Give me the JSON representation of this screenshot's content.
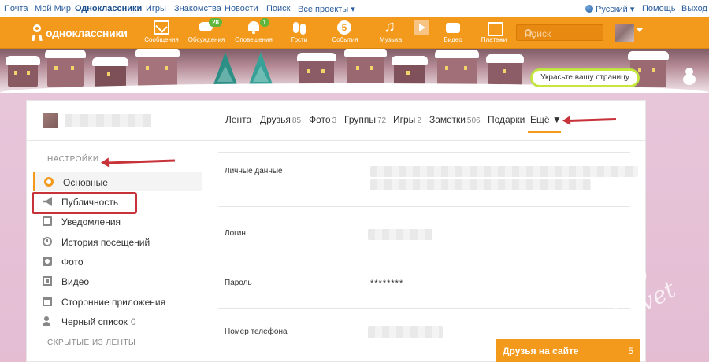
{
  "portal_bar": {
    "items": [
      "Почта",
      "Мой Мир",
      "Одноклассники",
      "Игры",
      "Знакомства",
      "Новости",
      "Поиск",
      "Все проекты"
    ],
    "language": "Русский",
    "help": "Помощь",
    "logout": "Выход"
  },
  "header": {
    "logo_text": "одноклассники",
    "nav": [
      {
        "label": "Сообщения",
        "icon": "mail-icon"
      },
      {
        "label": "Обсуждения",
        "icon": "chat-icon",
        "badge": "28"
      },
      {
        "label": "Оповещения",
        "icon": "bell-icon",
        "badge": "1"
      },
      {
        "label": "Гости",
        "icon": "guests-icon"
      },
      {
        "label": "События",
        "icon": "events-icon"
      },
      {
        "label": "Музыка",
        "icon": "music-icon"
      },
      {
        "label": "",
        "icon": "play-icon"
      },
      {
        "label": "Видео",
        "icon": "video-icon"
      },
      {
        "label": "Платежи",
        "icon": "payments-icon"
      }
    ],
    "search_placeholder": "Поиск"
  },
  "banner": {
    "decorate_label": "Украсьте вашу страницу"
  },
  "profile_tabs": [
    {
      "label": "Лента",
      "count": ""
    },
    {
      "label": "Друзья",
      "count": "85"
    },
    {
      "label": "Фото",
      "count": "3"
    },
    {
      "label": "Группы",
      "count": "72"
    },
    {
      "label": "Игры",
      "count": "2"
    },
    {
      "label": "Заметки",
      "count": "506"
    },
    {
      "label": "Подарки",
      "count": ""
    }
  ],
  "more_tab": "Ещё ▼",
  "sidebar": {
    "section_title": "НАСТРОЙКИ",
    "items": [
      {
        "label": "Основные",
        "icon": "gear-icon",
        "count": ""
      },
      {
        "label": "Публичность",
        "icon": "megaphone-icon",
        "count": ""
      },
      {
        "label": "Уведомления",
        "icon": "notifications-icon",
        "count": ""
      },
      {
        "label": "История посещений",
        "icon": "history-icon",
        "count": ""
      },
      {
        "label": "Фото",
        "icon": "photo-icon",
        "count": ""
      },
      {
        "label": "Видео",
        "icon": "video-icon",
        "count": ""
      },
      {
        "label": "Сторонние приложения",
        "icon": "apps-icon",
        "count": ""
      },
      {
        "label": "Черный список",
        "icon": "blacklist-icon",
        "count": "0"
      }
    ],
    "hidden_section_title": "СКРЫТЫЕ ИЗ ЛЕНТЫ"
  },
  "settings_rows": [
    {
      "label": "Личные данные"
    },
    {
      "label": "Логин"
    },
    {
      "label": "Пароль",
      "value": "********"
    },
    {
      "label": "Номер телефона"
    }
  ],
  "friends_online": {
    "label": "Друзья на сайте",
    "count": "5"
  },
  "watermark": "club Sovet",
  "colors": {
    "brand_orange": "#f39a1d",
    "annotation_red": "#c8333a",
    "link_blue": "#2a5d9e"
  }
}
